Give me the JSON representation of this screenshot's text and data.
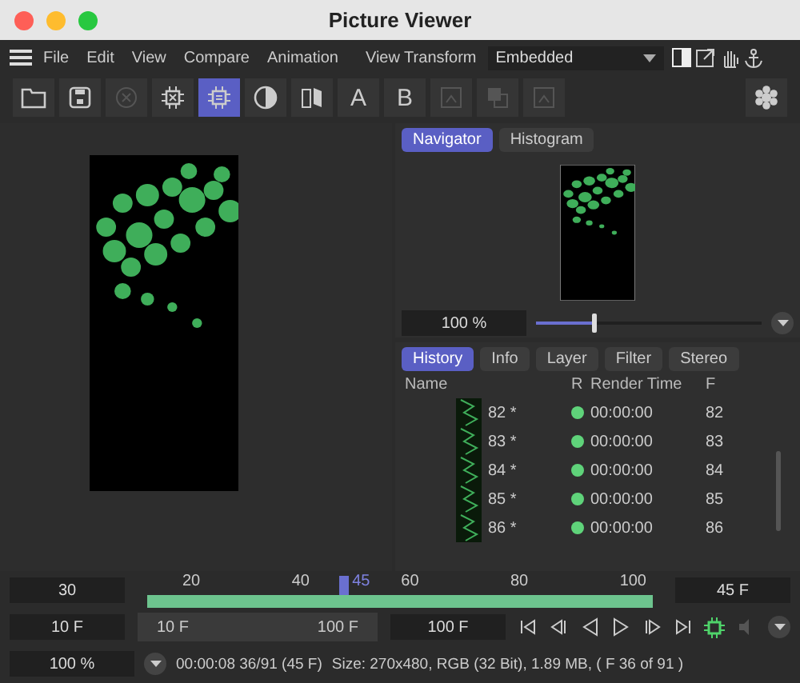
{
  "window": {
    "title": "Picture Viewer"
  },
  "menu": [
    "File",
    "Edit",
    "View",
    "Compare",
    "Animation"
  ],
  "view_transform": {
    "label": "View Transform",
    "value": "Embedded"
  },
  "toolbar": [
    {
      "kind": "icon",
      "selected": false,
      "disabled": false
    },
    {
      "kind": "icon",
      "selected": false,
      "disabled": false
    },
    {
      "kind": "icon",
      "selected": false,
      "disabled": true
    },
    {
      "kind": "icon",
      "selected": false,
      "disabled": false
    },
    {
      "kind": "icon",
      "selected": true,
      "disabled": false
    },
    {
      "kind": "icon",
      "selected": false,
      "disabled": false
    },
    {
      "kind": "icon",
      "selected": false,
      "disabled": false
    },
    {
      "kind": "text",
      "label": "A",
      "selected": false,
      "disabled": false
    },
    {
      "kind": "text",
      "label": "B",
      "selected": false,
      "disabled": false
    },
    {
      "kind": "icon",
      "selected": false,
      "disabled": true
    },
    {
      "kind": "icon",
      "selected": false,
      "disabled": true
    },
    {
      "kind": "icon",
      "selected": false,
      "disabled": true
    }
  ],
  "navigator": {
    "tabs": [
      {
        "label": "Navigator",
        "selected": true
      },
      {
        "label": "Histogram",
        "selected": false
      }
    ],
    "zoom": "100 %",
    "zoom_slider": {
      "level": 0.25
    }
  },
  "history": {
    "tabs": [
      {
        "label": "History",
        "selected": true
      },
      {
        "label": "Info",
        "selected": false
      },
      {
        "label": "Layer",
        "selected": false
      },
      {
        "label": "Filter",
        "selected": false
      },
      {
        "label": "Stereo",
        "selected": false
      }
    ],
    "columns": [
      "Name",
      "R",
      "Render Time",
      "F"
    ],
    "rows": [
      {
        "name": "82 *",
        "color": "#5fd37a",
        "time": "00:00:00",
        "frame": "82"
      },
      {
        "name": "83 *",
        "color": "#5fd37a",
        "time": "00:00:00",
        "frame": "83"
      },
      {
        "name": "84 *",
        "color": "#5fd37a",
        "time": "00:00:00",
        "frame": "84"
      },
      {
        "name": "85 *",
        "color": "#5fd37a",
        "time": "00:00:00",
        "frame": "85"
      },
      {
        "name": "86 *",
        "color": "#5fd37a",
        "time": "00:00:00",
        "frame": "86"
      }
    ]
  },
  "timeline": {
    "fps": "30",
    "ticks": [
      "20",
      "40",
      "60",
      "80",
      "100"
    ],
    "current": "45",
    "level": 0.38,
    "current_frame": "45 F",
    "start": "10 F",
    "range_start": "10 F",
    "range_end": "100 F",
    "end": "100 F"
  },
  "status": {
    "zoom": "100 %",
    "time": "00:00:08 36/91 (45 F)",
    "info": "Size: 270x480, RGB (32 Bit), 1.89 MB,  ( F 36 of 91 )"
  }
}
